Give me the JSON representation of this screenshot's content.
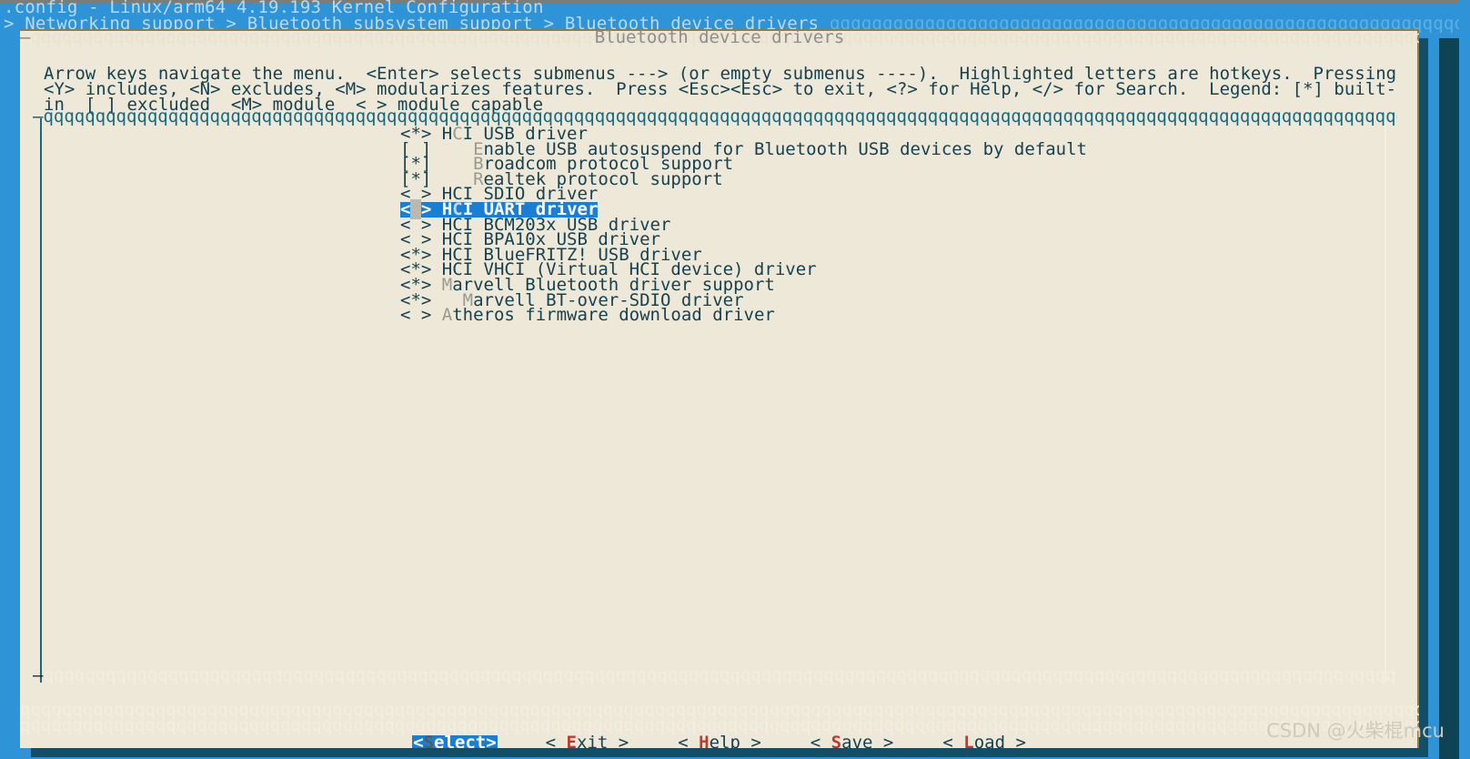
{
  "window": {
    "title": ".config - Linux/arm64 4.19.193 Kernel Configuration",
    "breadcrumb": "> Networking support > Bluetooth subsystem support > Bluetooth device drivers",
    "breadcrumb_fill": " qqqqqqqqqqqqqqqqqqqqqqqqqqqqqqqqqqqqqqqqqqqqqqqqqqqqqqqqqqqqqqqqqqqqqqqqqqqqqqqqqqqqqqqqqqqqq"
  },
  "dialog": {
    "title": "Bluetooth device drivers",
    "border_fill_left": "qqqqqqqqqqqqqqqqqqqqqqqqqqqqqqqqqqqqqqqqqqqqqqqqqqqqqqqqqqqqqqqqqq",
    "border_fill_right": "qqqqqqqqqqqqqqqqqqqqqqqqqqqqqqqqqqqqqqqqqqqqqqqqqqqqqqqqqqqqqqqqqqqqq",
    "help_text": "Arrow keys navigate the menu.  <Enter> selects submenus ---> (or empty submenus ----).  Highlighted letters are hotkeys.  Pressing <Y> includes, <N> excludes, <M> modularizes features.  Press <Esc><Esc> to exit, <?> for Help, </> for Search.  Legend: [*] built-in  [ ] excluded  <M> module  < > module capable"
  },
  "menu_box": {
    "top_border": "qqqqqqqqqqqqqqqqqqqqqqqqqqqqqqqqqqqqqqqqqqqqqqqqqqqqqqqqqqqqqqqqqqqqqqqqqqqqqqqqqqqqqqqqqqqqqqqqqqqqqqqqqqqqqqqqqqqqqqqqqqqqqqqqqqqqqqqqqqqqqqqqqqqqqqqqqqqqqqqqqqqqqqqqqqqqqqqqqqqqqqqqqqq",
    "bottom_border": "qqqqqqqqqqqqqqqqqqqqqqqqqqqqqqqqqqqqqqqqqqqqqqqqqqqqqqqqqqqqqqqqqqqqqqqqqqqqqqqqqqqqqqqqqqqqqqqqqqqqqqqqqqqqqqqqqqqqqqqqqqqqqqqqqqqqqqqqqqqqqqqqqqqqqqqqqqqqqqqqqqqqqqqqqqqqqqqqqqqqqqqqqqq",
    "filler_line": "qqqqqqqqqqqqqqqqqqqqqqqqqqqqqqqqqqqqqqqqqqqqqqqqqqqqqqqqqqqqqqqqqqqqqqqqqqqqqqqqqqqqqqqqqqqqqqqqqqqqqqqqqqqqqqqqqqqqqqqqqqqqqqqqqqqqqqqqqqqqqqqqqqqqqqqqqqqqqqqqqqqqqqqqqqqqqqqqqqqqqqqqqqqqqqqqqq"
  },
  "menu_items": [
    {
      "state": "<*>",
      "indent": "",
      "pre": "H",
      "hotkey": "C",
      "post": "I USB driver",
      "selected": false
    },
    {
      "state": "[ ]",
      "indent": "   ",
      "pre": "",
      "hotkey": "E",
      "post": "nable USB autosuspend for Bluetooth USB devices by default",
      "selected": false
    },
    {
      "state": "[*]",
      "indent": "   ",
      "pre": "",
      "hotkey": "B",
      "post": "roadcom protocol support",
      "selected": false
    },
    {
      "state": "[*]",
      "indent": "   ",
      "pre": "",
      "hotkey": "R",
      "post": "ealtek protocol support",
      "selected": false
    },
    {
      "state": "< >",
      "indent": "",
      "pre": "HCI SDIO driver",
      "hotkey": "",
      "post": "",
      "selected": false
    },
    {
      "state": "< >",
      "indent": "",
      "pre": "H",
      "hotkey": "C",
      "post": "I UART driver",
      "selected": true
    },
    {
      "state": "< >",
      "indent": "",
      "pre": "HCI BCM203x USB driver",
      "hotkey": "",
      "post": "",
      "selected": false
    },
    {
      "state": "< >",
      "indent": "",
      "pre": "HCI BPA10x USB driver",
      "hotkey": "",
      "post": "",
      "selected": false
    },
    {
      "state": "<*>",
      "indent": "",
      "pre": "HCI BlueFRITZ! USB driver",
      "hotkey": "",
      "post": "",
      "selected": false
    },
    {
      "state": "<*>",
      "indent": "",
      "pre": "HCI VHCI (Virtual HCI device) driver",
      "hotkey": "",
      "post": "",
      "selected": false
    },
    {
      "state": "<*>",
      "indent": "",
      "pre": "",
      "hotkey": "M",
      "post": "arvell Bluetooth driver support",
      "selected": false
    },
    {
      "state": "<*>",
      "indent": "  ",
      "pre": "",
      "hotkey": "M",
      "post": "arvell BT-over-SDIO driver",
      "selected": false
    },
    {
      "state": "< >",
      "indent": "",
      "pre": "",
      "hotkey": "A",
      "post": "theros firmware download driver",
      "selected": false
    }
  ],
  "buttons": [
    {
      "open": "<",
      "bracket_key": "S",
      "rest": "elect",
      "close": ">",
      "selected": true
    },
    {
      "open": "< ",
      "bracket_key": "E",
      "rest": "xit",
      "close": " >",
      "selected": false
    },
    {
      "open": "< ",
      "bracket_key": "H",
      "rest": "elp",
      "close": " >",
      "selected": false
    },
    {
      "open": "< ",
      "bracket_key": "S",
      "rest": "ave",
      "close": " >",
      "selected": false
    },
    {
      "open": "< ",
      "bracket_key": "L",
      "rest": "oad",
      "close": " >",
      "selected": false
    }
  ],
  "watermark": "CSDN @火柴棍mcu",
  "colors": {
    "backdrop_blue": "#2f93d8",
    "dialog_cream": "#ede8d8",
    "selection_blue": "#1a7fd4",
    "text_teal": "#17414f",
    "hotkey_grey": "#9a9a8f",
    "button_key_red": "#c0392b",
    "shadow_dark": "#0d4354"
  }
}
